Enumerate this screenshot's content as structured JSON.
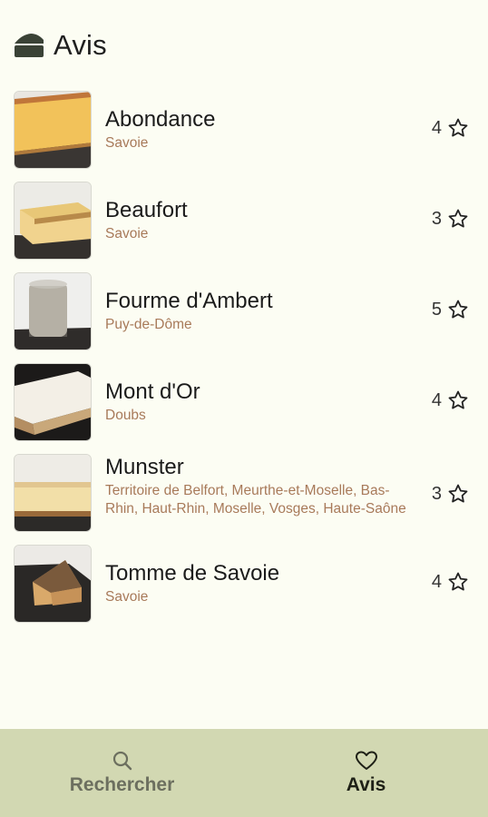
{
  "header": {
    "title": "Avis",
    "logo_icon": "cheese-icon"
  },
  "cheeses": [
    {
      "name": "Abondance",
      "region": "Savoie",
      "rating": "4"
    },
    {
      "name": "Beaufort",
      "region": "Savoie",
      "rating": "3"
    },
    {
      "name": "Fourme d'Ambert",
      "region": "Puy-de-Dôme",
      "rating": "5"
    },
    {
      "name": "Mont d'Or",
      "region": "Doubs",
      "rating": "4"
    },
    {
      "name": "Munster",
      "region": "Territoire de Belfort, Meurthe-et-Moselle, Bas-Rhin, Haut-Rhin, Moselle, Vosges, Haute-Saône",
      "rating": "3"
    },
    {
      "name": "Tomme de Savoie",
      "region": "Savoie",
      "rating": "4"
    }
  ],
  "nav": {
    "search_label": "Rechercher",
    "search_icon": "search-icon",
    "reviews_label": "Avis",
    "reviews_icon": "heart-icon"
  },
  "colors": {
    "background": "#fcfdf3",
    "bottom_bar": "#d2d8b2",
    "region_text": "#a87a5a"
  }
}
